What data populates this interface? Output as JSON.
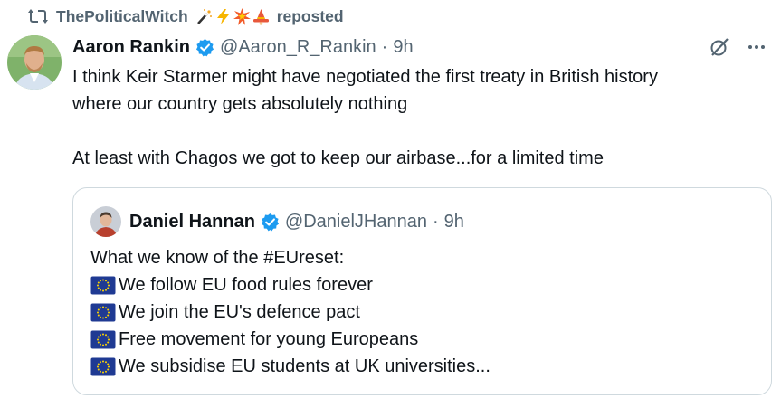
{
  "repost": {
    "username": "ThePoliticalWitch",
    "emojis": [
      "magic-wand-icon",
      "lightning-icon",
      "collision-icon",
      "witch-hat-icon"
    ],
    "suffix": "reposted"
  },
  "tweet": {
    "author_name": "Aaron Rankin",
    "handle": "@Aaron_R_Rankin",
    "separator": "·",
    "time": "9h",
    "lines": [
      "I think Keir Starmer might have negotiated the first treaty in British history",
      "where our country gets absolutely nothing"
    ],
    "line_after_gap": "At least with Chagos we got to keep our airbase...for a limited time"
  },
  "quote": {
    "author_name": "Daniel Hannan",
    "handle": "@DanielJHannan",
    "separator": "·",
    "time": "9h",
    "intro": "What we know of the #EUreset:",
    "items": [
      "We follow EU food rules forever",
      "We join the EU's defence pact",
      "Free movement for young Europeans",
      "We subsidise EU students at UK universities..."
    ]
  },
  "colors": {
    "text": "#0f1419",
    "secondary": "#536471",
    "verified": "#1d9bf0",
    "border": "#cfd9de",
    "eu_blue": "#1f3a93",
    "eu_gold": "#ffd500"
  }
}
